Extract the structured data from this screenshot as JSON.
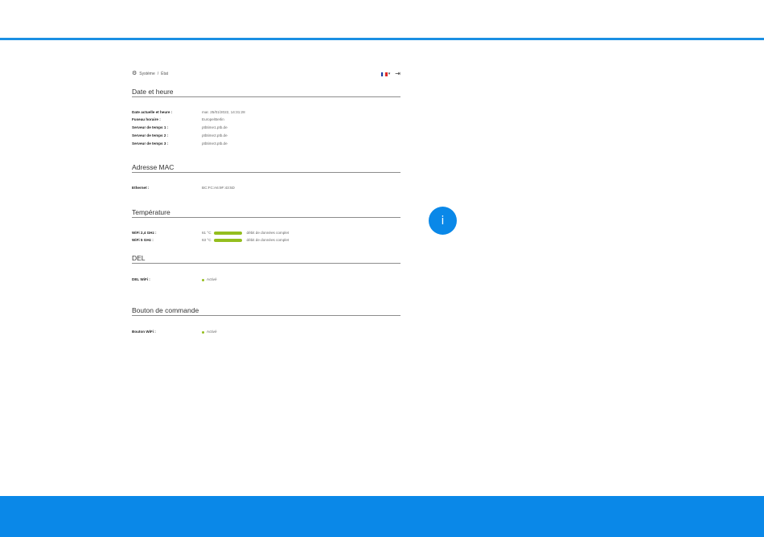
{
  "breadcrumb": {
    "parent": "Système",
    "separator": "/",
    "current": "État"
  },
  "colors": {
    "accent": "#0a88e8",
    "bar": "#94be1e"
  },
  "language": {
    "flag": "fr-flag-icon",
    "caret": "▾"
  },
  "sections": {
    "datetime": {
      "title": "Date et heure",
      "rows": [
        {
          "label": "Date actuelle et heure :",
          "value": "mar. 25/01/2022, 14:31:28"
        },
        {
          "label": "Fuseau horaire :",
          "value": "Europe/Berlin"
        },
        {
          "label": "Serveur de temps 1 :",
          "value": "ptbtime1.ptb.de"
        },
        {
          "label": "Serveur de temps 2 :",
          "value": "ptbtime2.ptb.de"
        },
        {
          "label": "Serveur de temps 3 :",
          "value": "ptbtime3.ptb.de"
        }
      ]
    },
    "mac": {
      "title": "Adresse MAC",
      "rows": [
        {
          "label": "Ethernet :",
          "value": "BC:FC:A6:9F:43:5D"
        }
      ]
    },
    "temperature": {
      "title": "Température",
      "rows": [
        {
          "label": "WiFi 2,4 GHz :",
          "value": "61 °C",
          "status": "débit de données complet",
          "level": 1.0
        },
        {
          "label": "WiFi 5 GHz :",
          "value": "63 °C",
          "status": "débit de données complet",
          "level": 1.0
        }
      ]
    },
    "led": {
      "title": "DEL",
      "rows": [
        {
          "label": "DEL WiFi :",
          "value": "Activé"
        }
      ]
    },
    "button": {
      "title": "Bouton de commande",
      "rows": [
        {
          "label": "Bouton WiFi :",
          "value": "Activé"
        }
      ]
    }
  },
  "info_button": {
    "label": "i"
  }
}
